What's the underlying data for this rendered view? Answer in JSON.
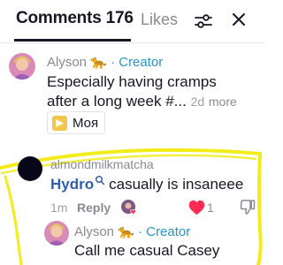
{
  "header": {
    "tab_comments": "Comments 176",
    "tab_likes": "Likes",
    "filter_icon": "sliders-icon",
    "close_icon": "close-icon"
  },
  "comments": [
    {
      "username": "Alyson",
      "username_emoji": "🐆",
      "separator": "·",
      "badge": "Creator",
      "text_line1": "Especially having cramps",
      "text_line2": "after a long week #...",
      "time": "2d",
      "more_label": "more",
      "chip_label": "Моя",
      "avatar_icon": "creator-avatar"
    },
    {
      "username": "almondmilkmatcha",
      "mention": "Hydro",
      "text": "casually is insaneee",
      "time": "1m",
      "reply_label": "Reply",
      "like_count": "1",
      "avatar_icon": "dark-avatar",
      "replies": [
        {
          "username": "Alyson",
          "username_emoji": "🐆",
          "separator": "·",
          "badge": "Creator",
          "text": "Call me casual Casey",
          "avatar_icon": "creator-avatar"
        }
      ]
    }
  ],
  "colors": {
    "creator_badge": "#2a95c6",
    "mention": "#2f5fb0",
    "heart": "#fe2c55",
    "scribble": "#f2ec1b"
  }
}
